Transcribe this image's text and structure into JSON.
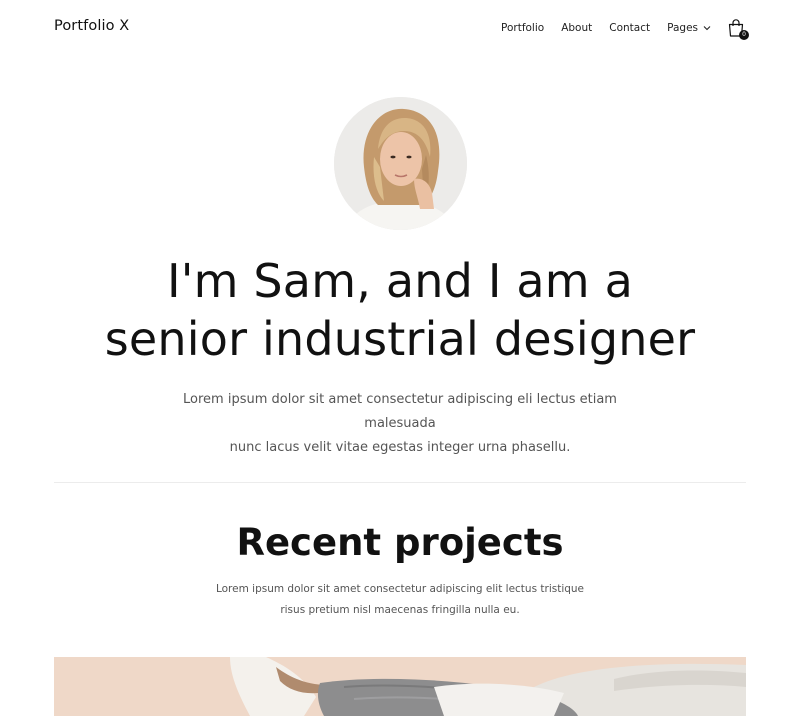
{
  "header": {
    "logo": "Portfolio X",
    "nav": [
      {
        "label": "Portfolio"
      },
      {
        "label": "About"
      },
      {
        "label": "Contact"
      },
      {
        "label": "Pages"
      }
    ],
    "cart_count": "0",
    "icons": {
      "dropdown": "chevron-down-icon",
      "cart": "shopping-bag-icon"
    }
  },
  "hero": {
    "title_line1": "I'm Sam, and I am a",
    "title_line2": "senior industrial designer",
    "text_line1": "Lorem ipsum dolor sit amet consectetur adipiscing eli lectus etiam malesuada",
    "text_line2": "nunc lacus velit vitae egestas integer urna phasellu."
  },
  "projects": {
    "title": "Recent projects",
    "text_line1": "Lorem ipsum dolor sit amet consectetur adipiscing elit lectus tristique",
    "text_line2": "risus pretium nisl maecenas fringilla nulla eu."
  },
  "colors": {
    "text": "#111111",
    "muted": "#555555",
    "divider": "#ececec",
    "project_bg": "#efd8c8"
  }
}
